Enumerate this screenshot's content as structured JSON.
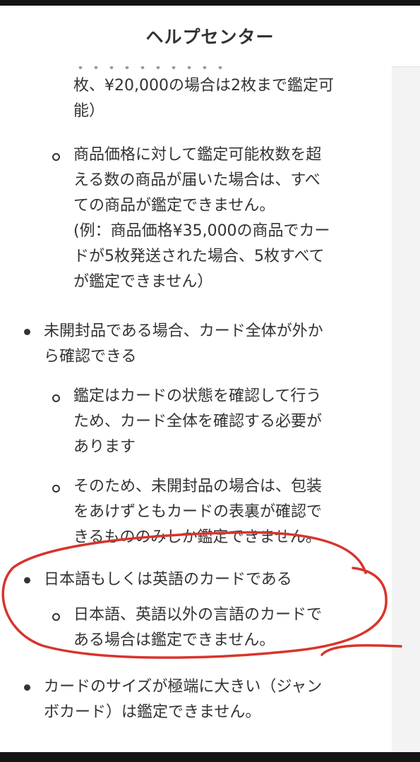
{
  "header": {
    "title": "ヘルプセンター"
  },
  "content": {
    "cut_off_line": "・・・・・・・・・・",
    "sub_a": {
      "lines": [
        "枚、¥20,000の場合は2枚まで鑑定可",
        "能）"
      ]
    },
    "sub_b": {
      "lines": [
        "商品価格に対して鑑定可能枚数を超",
        "える数の商品が届いた場合は、すべ",
        "ての商品が鑑定できません。",
        "(例：商品価格¥35,000の商品でカー",
        "ドが5枚発送された場合、5枚すべて",
        "が鑑定できません）"
      ]
    },
    "item_unopened": {
      "lines": [
        "未開封品である場合、カード全体が外か",
        "ら確認できる"
      ],
      "subs": [
        {
          "lines": [
            "鑑定はカードの状態を確認して行う",
            "ため、カード全体を確認する必要が",
            "あります"
          ]
        },
        {
          "lines": [
            "そのため、未開封品の場合は、包装",
            "をあけずともカードの表裏が確認で",
            "きるもののみしか鑑定できません。"
          ]
        }
      ]
    },
    "item_language": {
      "lines": [
        "日本語もしくは英語のカードである"
      ],
      "subs": [
        {
          "lines": [
            "日本語、英語以外の言語のカードで",
            "ある場合は鑑定できません。"
          ]
        }
      ]
    },
    "item_size": {
      "lines": [
        "カードのサイズが極端に大きい（ジャン",
        "ボカード）は鑑定できません。"
      ]
    }
  },
  "annotation": {
    "color": "#d8342c"
  }
}
